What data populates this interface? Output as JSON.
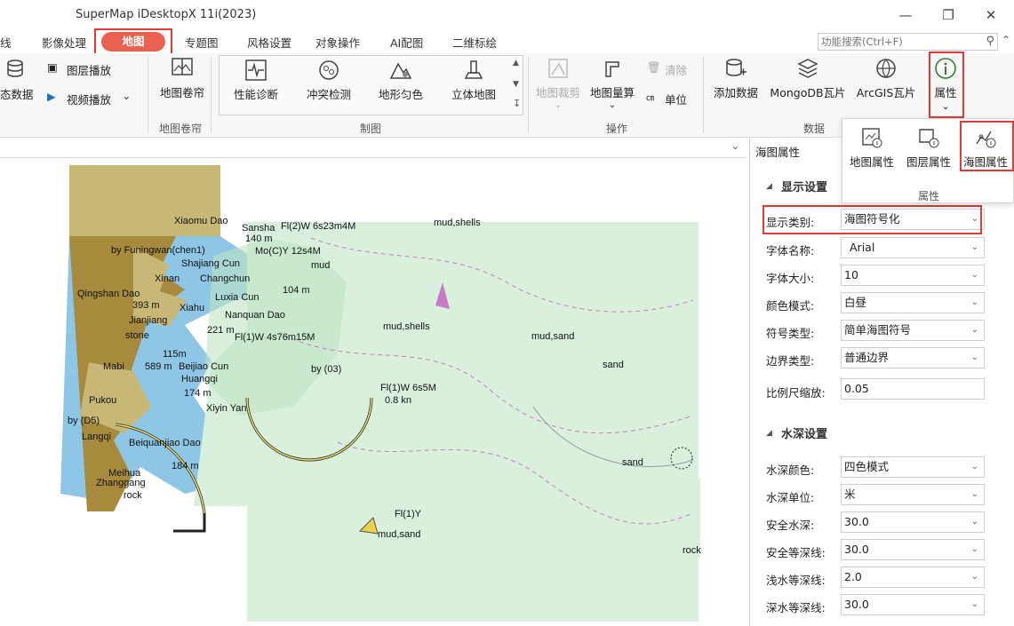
{
  "window": {
    "title": "SuperMap iDesktopX 11i(2023)"
  },
  "tabs": [
    {
      "label": "线"
    },
    {
      "label": "影像处理"
    },
    {
      "label": "地图"
    },
    {
      "label": "专题图"
    },
    {
      "label": "风格设置"
    },
    {
      "label": "对象操作"
    },
    {
      "label": "AI配图"
    },
    {
      "label": "二维标绘"
    }
  ],
  "search": {
    "placeholder": "功能搜索(Ctrl+F)"
  },
  "ribbon": {
    "left": {
      "dynamic_data": "态数据",
      "layer_play": "图层播放",
      "video_play": "视频播放"
    },
    "map_curtain": {
      "label": "地图卷帘",
      "group": "地图卷帘"
    },
    "draw": {
      "items": [
        "性能诊断",
        "冲突检测",
        "地形匀色",
        "立体地图"
      ],
      "group": "制图"
    },
    "ops": {
      "clip": "地图裁剪",
      "measure": "地图量算",
      "clear": "清除",
      "unit": "单位",
      "group": "操作"
    },
    "data": {
      "add": "添加数据",
      "mongo": "MongoDB瓦片",
      "arcgis": "ArcGIS瓦片",
      "group": "数据"
    },
    "property": {
      "label": "属性"
    }
  },
  "property_dropdown": {
    "items": [
      "地图属性",
      "图层属性",
      "海图属性"
    ],
    "group": "属性"
  },
  "panel": {
    "title": "海图属性",
    "display_section": "显示设置",
    "depth_section": "水深设置",
    "display_rows": [
      {
        "label": "显示类别:",
        "value": "海图符号化"
      },
      {
        "label": "字体名称:",
        "value": "Arial"
      },
      {
        "label": "字体大小:",
        "value": "10"
      },
      {
        "label": "颜色模式:",
        "value": "白昼"
      },
      {
        "label": "符号类型:",
        "value": "简单海图符号"
      },
      {
        "label": "边界类型:",
        "value": "普通边界"
      },
      {
        "label": "比例尺缩放:",
        "value": "0.05"
      }
    ],
    "depth_rows": [
      {
        "label": "水深颜色:",
        "value": "四色模式"
      },
      {
        "label": "水深单位:",
        "value": "米"
      },
      {
        "label": "安全水深:",
        "value": "30.0"
      },
      {
        "label": "安全等深线:",
        "value": "30.0"
      },
      {
        "label": "浅水等深线:",
        "value": "2.0"
      },
      {
        "label": "深水等深线:",
        "value": "30.0"
      }
    ]
  },
  "map_labels": [
    "Xiaomu Dao",
    "Sansha",
    "Fl(2)W 6s23m4M",
    "140 m",
    "Mo(C)Y 12s4M",
    "by Funingwan(chen1)",
    "Shajiang Cun",
    "Xinan",
    "Changchun",
    "mud",
    "Qingshan Dao",
    "Luxia Cun",
    "104 m",
    "393 m",
    "Xiahu",
    "Nanquan Dao",
    "Jianjiang",
    "221 m",
    "Fl(1)W 4s76m15M",
    "stone",
    "mud,shells",
    "Mabi",
    "115m",
    "589 m",
    "Beijiao Cun",
    "by (03)",
    "Huangqi",
    "174 m",
    "Fl(1)W 6s5M",
    "0.8 kn",
    "Pukou",
    "Xiyin Yan",
    "by (D5)",
    "Langqi",
    "Beiquanjiao Dao",
    "184 m",
    "Meihua",
    "Zhanggang",
    "rock",
    "mud,sand",
    "Fl(1)Y",
    "sand",
    "mud,shells",
    "mud,sand",
    "sand",
    "rock"
  ],
  "colors": {
    "tab_active": "#e8624f",
    "highlight": "#e53935",
    "land": "#c8b878",
    "sea": "#d8f0dc",
    "shallow": "#8ec6e6",
    "urban": "#a88a3c"
  }
}
